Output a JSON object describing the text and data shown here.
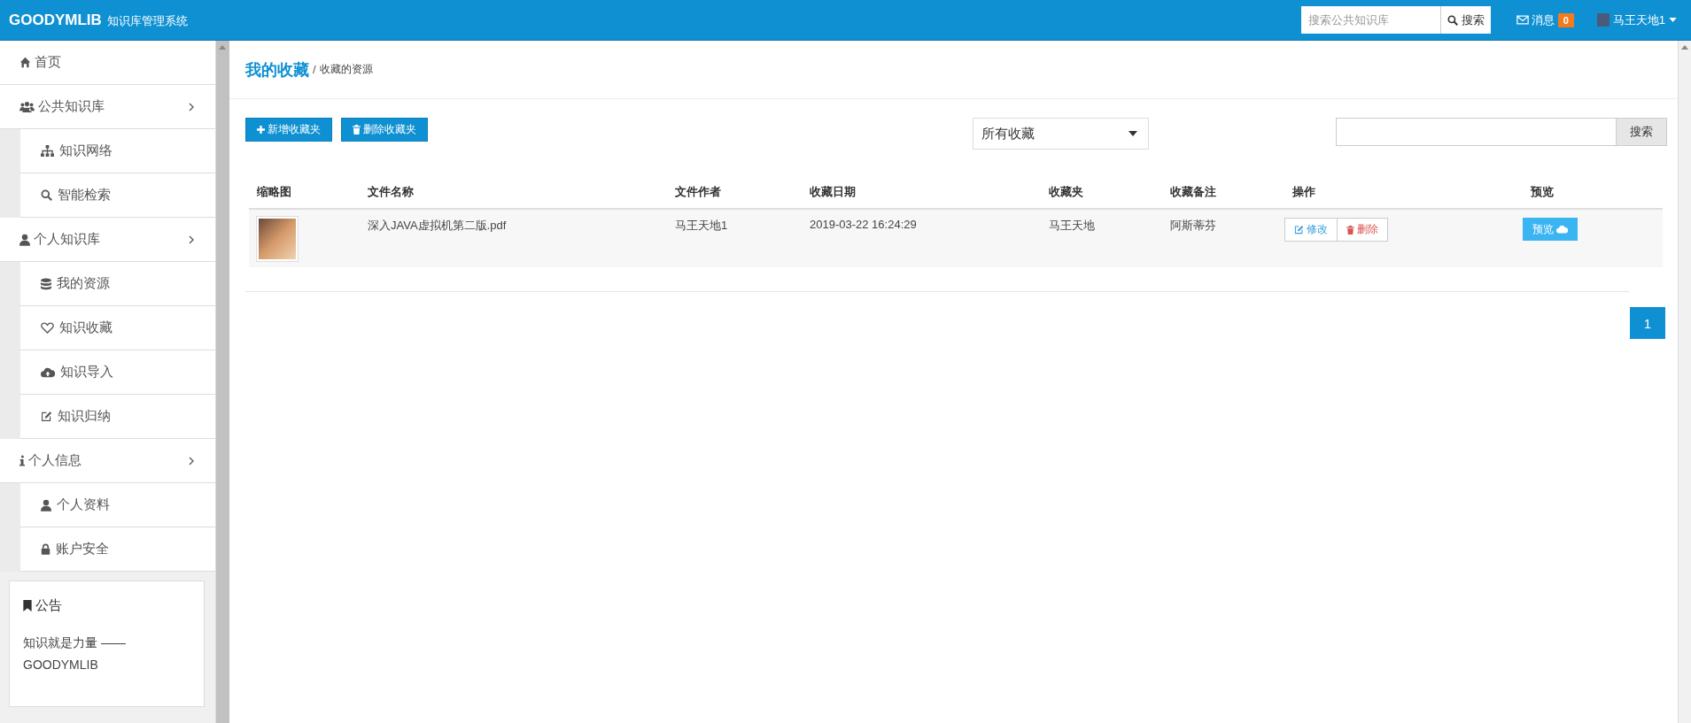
{
  "header": {
    "brand": "GOODYMLIB",
    "subtitle": "知识库管理系统",
    "search": {
      "placeholder": "搜索公共知识库",
      "button": "搜索"
    },
    "messages": {
      "label": "消息",
      "count": "0"
    },
    "user": {
      "name": "马王天地1"
    }
  },
  "sidebar": {
    "items": [
      {
        "label": "首页"
      },
      {
        "label": "公共知识库",
        "children": [
          {
            "label": "知识网络"
          },
          {
            "label": "智能检索"
          }
        ]
      },
      {
        "label": "个人知识库",
        "children": [
          {
            "label": "我的资源"
          },
          {
            "label": "知识收藏"
          },
          {
            "label": "知识导入"
          },
          {
            "label": "知识归纳"
          }
        ]
      },
      {
        "label": "个人信息",
        "children": [
          {
            "label": "个人资料"
          },
          {
            "label": "账户安全"
          }
        ]
      }
    ],
    "notice": {
      "title": "公告",
      "text": "知识就是力量 —— GOODYMLIB"
    }
  },
  "page": {
    "title": "我的收藏",
    "separator": "/",
    "subtitle": "收藏的资源"
  },
  "toolbar": {
    "buttons": [
      "新增收藏夹",
      "删除收藏夹"
    ],
    "folder_select": {
      "value": "所有收藏"
    },
    "search": {
      "button": "搜索"
    }
  },
  "table": {
    "columns": [
      "缩略图",
      "文件名称",
      "文件作者",
      "收藏日期",
      "收藏夹",
      "收藏备注",
      "操作",
      "预览"
    ],
    "rows": [
      {
        "file_name": "深入JAVA虚拟机第二版.pdf",
        "author": "马王天地1",
        "date": "2019-03-22 16:24:29",
        "folder": "马王天地",
        "note": "阿斯蒂芬",
        "actions": [
          "修改",
          "删除"
        ],
        "preview": "预览"
      }
    ]
  },
  "pagination": [
    {
      "label": "1",
      "selected": true
    }
  ]
}
